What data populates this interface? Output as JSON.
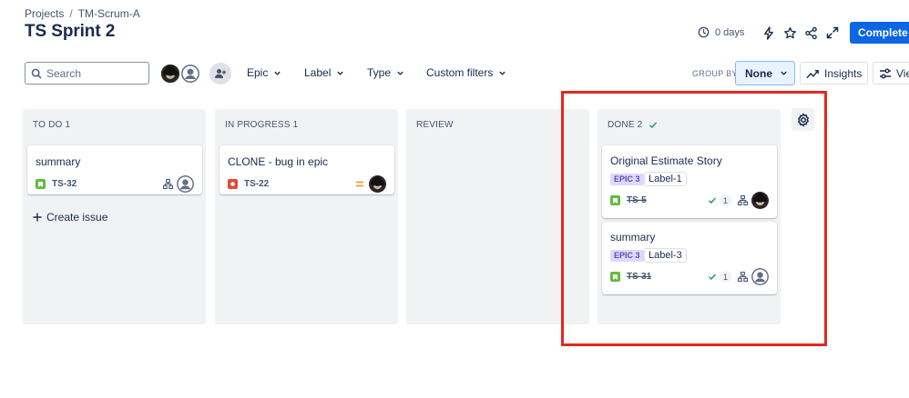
{
  "breadcrumb": {
    "projects": "Projects",
    "separator": "/",
    "project": "TM-Scrum-A"
  },
  "page_title": "TS Sprint 2",
  "header": {
    "days_remaining": "0 days",
    "complete_button": "Complete s"
  },
  "toolbar": {
    "search_placeholder": "Search",
    "filters": [
      "Epic",
      "Label",
      "Type",
      "Custom filters"
    ],
    "group_by_label": "GROUP BY",
    "group_by_value": "None",
    "insights_label": "Insights",
    "view_label": "Vie"
  },
  "columns": [
    {
      "title": "TO DO 1"
    },
    {
      "title": "IN PROGRESS 1"
    },
    {
      "title": "REVIEW"
    },
    {
      "title": "DONE 2"
    }
  ],
  "cards": {
    "todo": {
      "title": "summary",
      "key": "TS-32",
      "type": "story"
    },
    "inprogress": {
      "title": "CLONE - bug in epic",
      "key": "TS-22",
      "type": "bug",
      "priority": "medium"
    },
    "done1": {
      "title": "Original Estimate Story",
      "epic": "EPIC 3",
      "label": "Label-1",
      "key": "TS-5",
      "subtask_count": "1"
    },
    "done2": {
      "title": "summary",
      "epic": "EPIC 3",
      "label": "Label-3",
      "key": "TS-31",
      "subtask_count": "1"
    }
  },
  "create_issue_label": "Create issue",
  "colors": {
    "brand_blue": "#0c66e4",
    "story_green": "#63ba3c",
    "bug_red": "#e5493a",
    "epic_purple": "#dfd8fd",
    "highlight_red": "#e4281e",
    "done_check": "#22a06b"
  },
  "icons": [
    "clock-icon",
    "lightning-icon",
    "star-icon",
    "share-icon",
    "fullscreen-icon",
    "search-icon",
    "add-people-icon",
    "chevron-down-icon",
    "insights-icon",
    "view-settings-icon",
    "story-icon",
    "bug-icon",
    "child-issues-icon",
    "priority-medium-icon",
    "check-icon",
    "plus-icon",
    "gear-icon"
  ]
}
